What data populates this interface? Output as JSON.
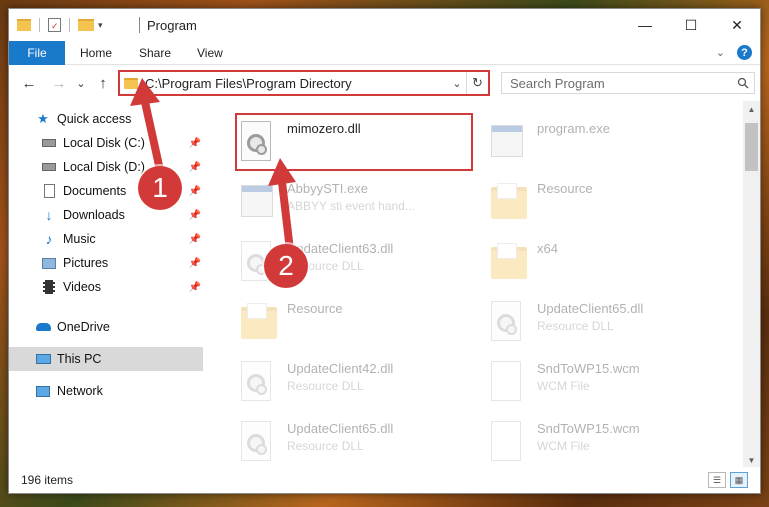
{
  "window": {
    "title": "Program",
    "controls": {
      "minimize": "—",
      "maximize": "☐",
      "close": "✕"
    }
  },
  "ribbon": {
    "tabs": [
      {
        "label": "File"
      },
      {
        "label": "Home"
      },
      {
        "label": "Share"
      },
      {
        "label": "View"
      }
    ],
    "expand_icon": "chevron-down-icon",
    "help": "?"
  },
  "navbar": {
    "back": "←",
    "forward": "→",
    "recent": "⌄",
    "up": "↑",
    "address": "C:\\Program Files\\Program Directory",
    "refresh": "↻",
    "search_placeholder": "Search Program"
  },
  "sidebar": {
    "items": [
      {
        "label": "Quick access",
        "icon": "star-icon",
        "pinned": false
      },
      {
        "label": "Local Disk (C:)",
        "icon": "drive-icon",
        "pinned": true
      },
      {
        "label": "Local Disk (D:)",
        "icon": "drive-icon",
        "pinned": true
      },
      {
        "label": "Documents",
        "icon": "documents-icon",
        "pinned": true
      },
      {
        "label": "Downloads",
        "icon": "download-icon",
        "pinned": true
      },
      {
        "label": "Music",
        "icon": "music-icon",
        "pinned": true
      },
      {
        "label": "Pictures",
        "icon": "pictures-icon",
        "pinned": true
      },
      {
        "label": "Videos",
        "icon": "videos-icon",
        "pinned": true
      },
      {
        "label": "OneDrive",
        "icon": "cloud-icon",
        "pinned": false
      },
      {
        "label": "This PC",
        "icon": "computer-icon",
        "pinned": false
      },
      {
        "label": "Network",
        "icon": "network-icon",
        "pinned": false
      }
    ]
  },
  "files": [
    {
      "name": "mimozero.dll",
      "type": "",
      "icon": "dll"
    },
    {
      "name": "program.exe",
      "type": "",
      "icon": "exe"
    },
    {
      "name": "AbbyySTI.exe",
      "type": "ABBYY sti event hand...",
      "icon": "exe"
    },
    {
      "name": "Resource",
      "type": "",
      "icon": "folder"
    },
    {
      "name": "UpdateClient63.dll",
      "type": "Resource DLL",
      "icon": "dll"
    },
    {
      "name": "x64",
      "type": "",
      "icon": "folder"
    },
    {
      "name": "Resource",
      "type": "",
      "icon": "folder"
    },
    {
      "name": "UpdateClient65.dll",
      "type": "Resource DLL",
      "icon": "dll"
    },
    {
      "name": "UpdateClient42.dll",
      "type": "Resource DLL",
      "icon": "dll"
    },
    {
      "name": "SndToWP15.wcm",
      "type": "WCM File",
      "icon": "blank"
    },
    {
      "name": "UpdateClient65.dll",
      "type": "Resource DLL",
      "icon": "dll"
    },
    {
      "name": "SndToWP15.wcm",
      "type": "WCM File",
      "icon": "blank"
    }
  ],
  "status": {
    "item_count": "196 items"
  },
  "annotations": {
    "step1": "1",
    "step2": "2"
  },
  "colors": {
    "accent": "#1979ca",
    "highlight": "#d23a3a"
  }
}
